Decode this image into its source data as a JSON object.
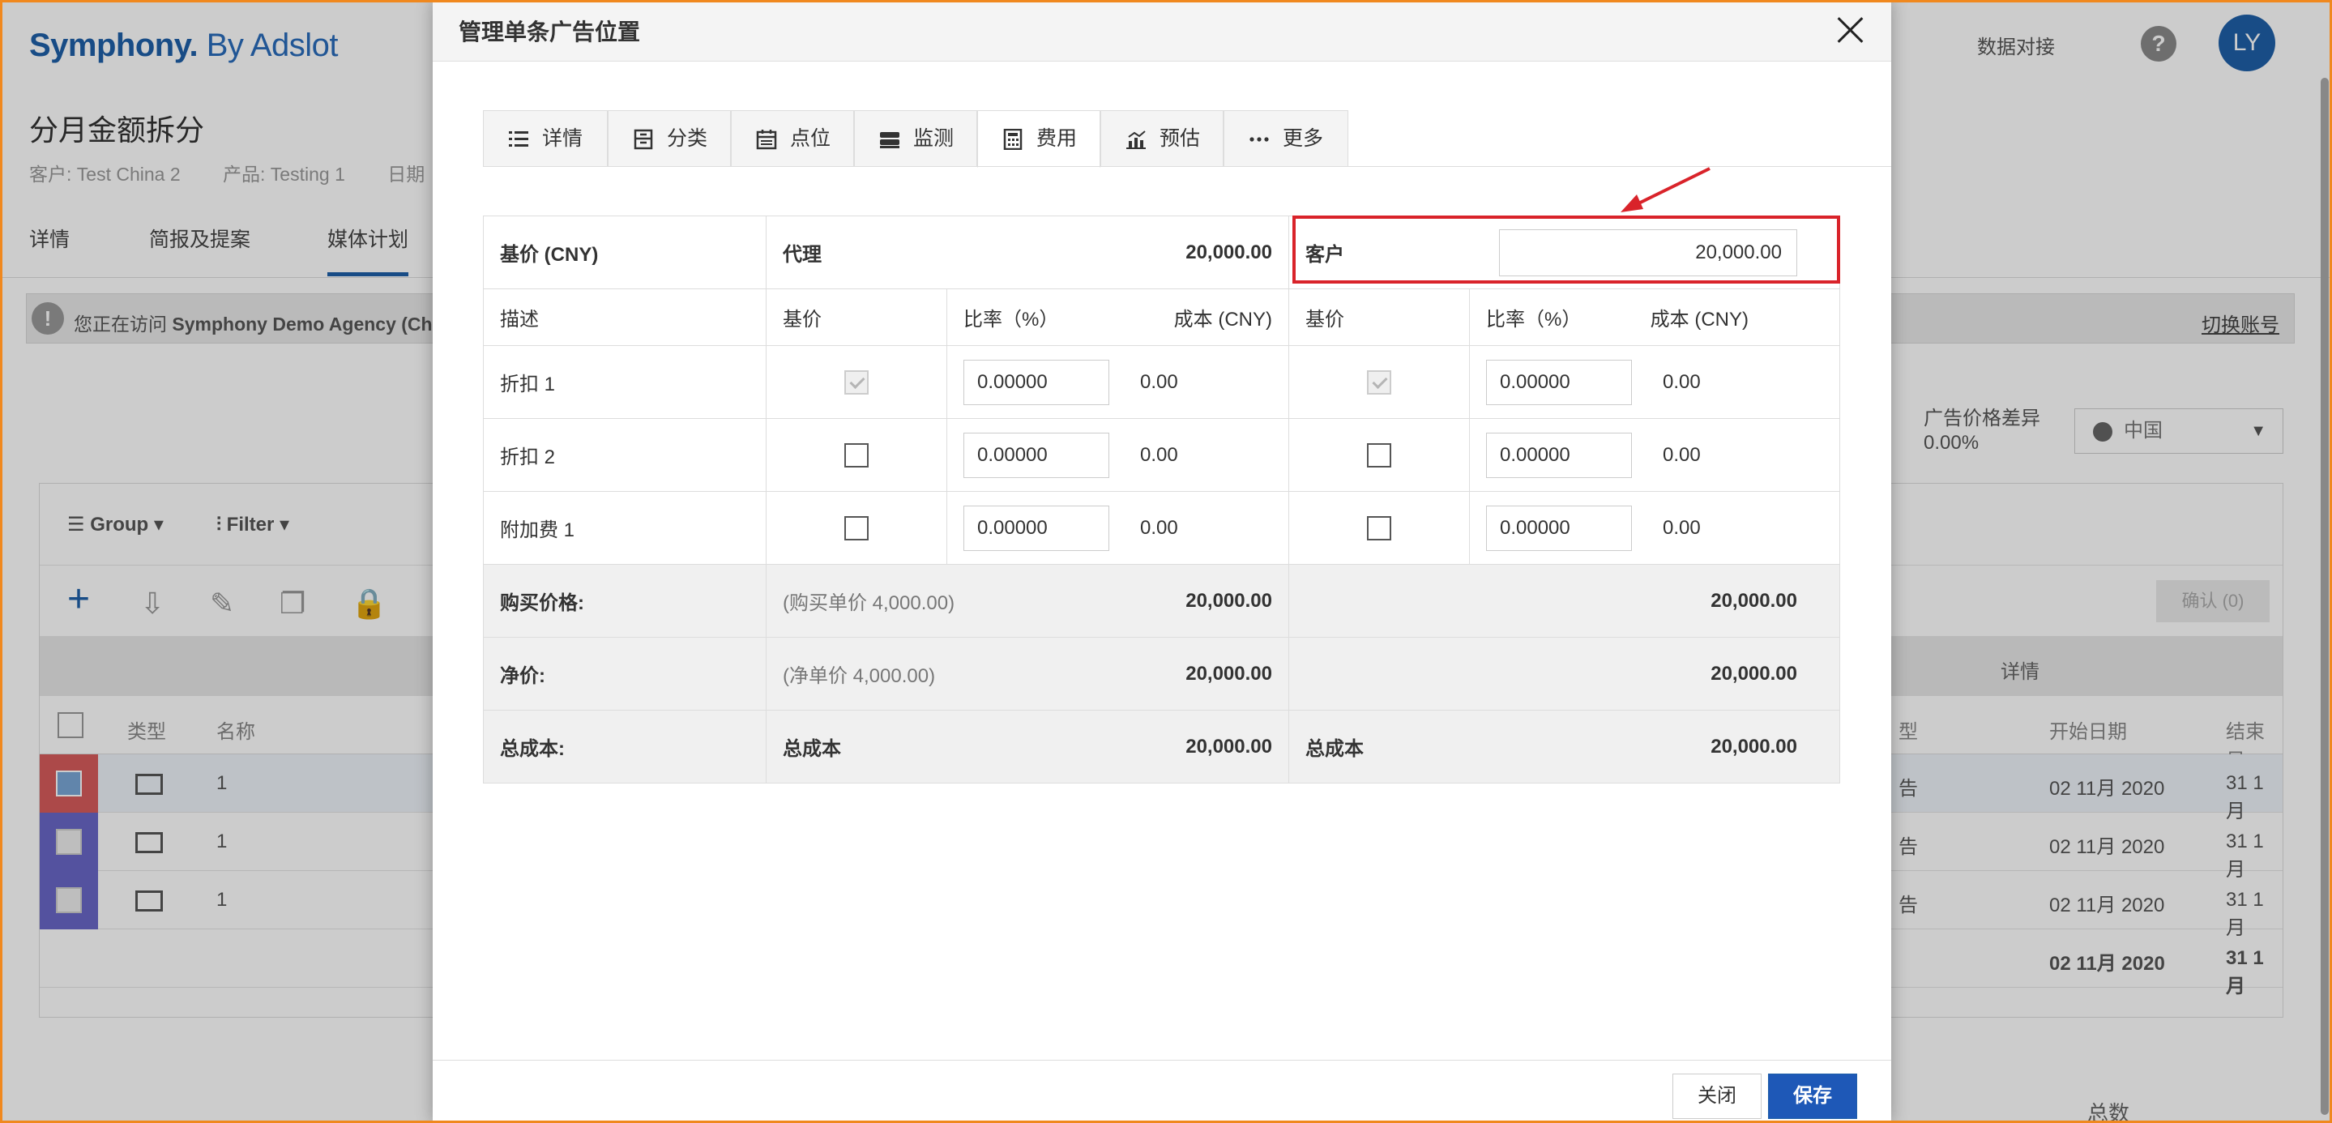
{
  "app": {
    "logo_brand": "Symphony.",
    "logo_sub": " By Adslot",
    "top_link": "数据对接",
    "help": "?",
    "avatar": "LY",
    "page_title": "分月金额拆分",
    "meta": [
      "客户: Test China 2",
      "产品: Testing 1",
      "日期"
    ],
    "nav_tabs": [
      "详情",
      "简报及提案",
      "媒体计划"
    ],
    "notice_prefix": "您正在访问 ",
    "notice_agency": "Symphony Demo Agency (Chi",
    "notice_link": "切换账号",
    "price_diff_label": "广告价格差异",
    "price_diff_value": "0.00%",
    "region": "中国",
    "grid": {
      "group_label": "Group",
      "filter_label": "Filter",
      "confirm_label": "确认 (0)",
      "group_header": "详情",
      "columns": [
        "类型",
        "名称",
        "型",
        "开始日期",
        "结束日"
      ],
      "rows": [
        {
          "name": "1",
          "type": "告",
          "start": "02 11月 2020",
          "end": "31 1月"
        },
        {
          "name": "1",
          "type": "告",
          "start": "02 11月 2020",
          "end": "31 1月"
        },
        {
          "name": "1",
          "type": "告",
          "start": "02 11月 2020",
          "end": "31 1月"
        }
      ],
      "total_row": {
        "start": "02 11月 2020",
        "end": "31 1月"
      }
    },
    "bottom_total": "总数",
    "colors": {
      "brand": "#1f5fa8",
      "highlight": "#d9232a",
      "row_selected": "#d85c5c",
      "row_marker": "#6a67c7"
    }
  },
  "modal": {
    "title": "管理单条广告位置",
    "tabs": [
      {
        "label": "详情",
        "icon": "list-icon"
      },
      {
        "label": "分类",
        "icon": "archive-icon"
      },
      {
        "label": "点位",
        "icon": "calendar-icon"
      },
      {
        "label": "监测",
        "icon": "server-icon"
      },
      {
        "label": "费用",
        "icon": "calculator-icon"
      },
      {
        "label": "预估",
        "icon": "bar-chart-icon"
      },
      {
        "label": "更多",
        "icon": "more-icon"
      }
    ],
    "active_tab": "费用",
    "table": {
      "base_price_label": "基价 (CNY)",
      "agency_label": "代理",
      "agency_value": "20,000.00",
      "client_label": "客户",
      "client_value": "20,000.00",
      "col_desc": "描述",
      "col_base": "基价",
      "col_rate": "比率（%）",
      "col_cost": "成本 (CNY)",
      "rows": [
        {
          "label": "折扣 1",
          "checked": true,
          "agency_rate": "0.00000",
          "agency_cost": "0.00",
          "client_rate": "0.00000",
          "client_cost": "0.00"
        },
        {
          "label": "折扣 2",
          "checked": false,
          "agency_rate": "0.00000",
          "agency_cost": "0.00",
          "client_rate": "0.00000",
          "client_cost": "0.00"
        },
        {
          "label": "附加费 1",
          "checked": false,
          "agency_rate": "0.00000",
          "agency_cost": "0.00",
          "client_rate": "0.00000",
          "client_cost": "0.00"
        }
      ],
      "buy_price_label": "购买价格:",
      "buy_unit_note": "(购买单价  4,000.00)",
      "buy_agency": "20,000.00",
      "buy_client": "20,000.00",
      "net_price_label": "净价:",
      "net_unit_note": "(净单价  4,000.00)",
      "net_agency": "20,000.00",
      "net_client": "20,000.00",
      "total_cost_label": "总成本:",
      "total_cost_sub": "总成本",
      "total_agency": "20,000.00",
      "total_client": "20,000.00"
    },
    "close_button": "关闭",
    "save_button": "保存"
  }
}
